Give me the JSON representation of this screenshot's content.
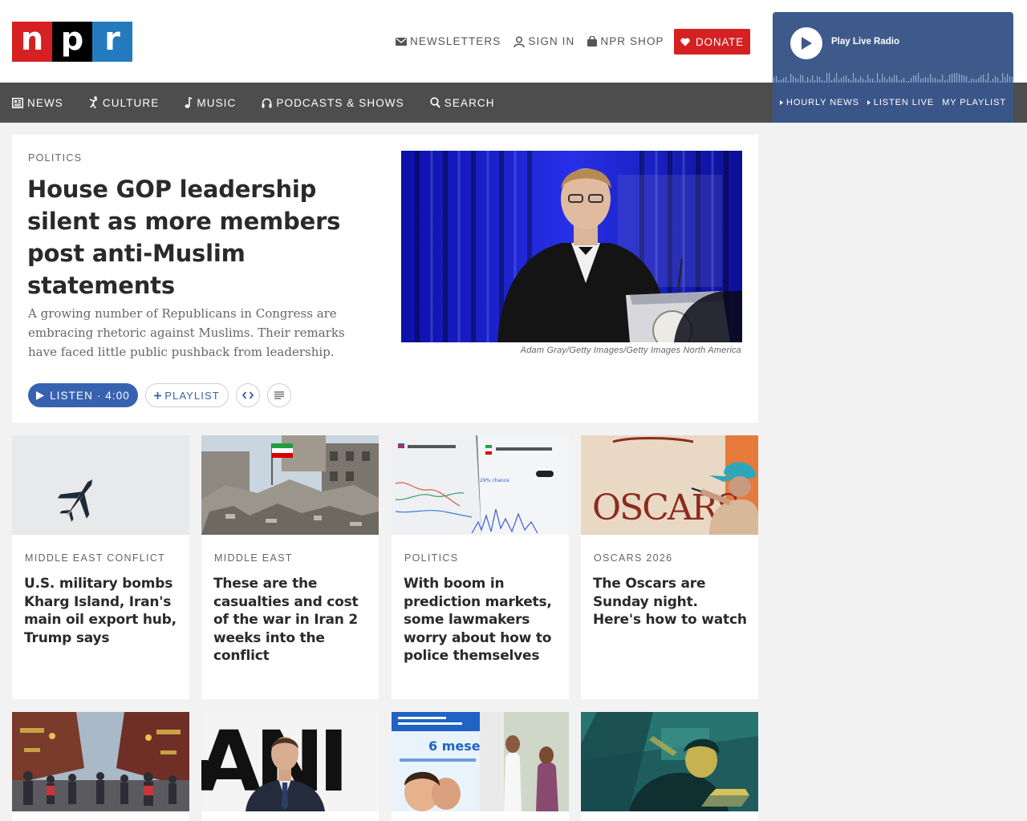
{
  "logo": {
    "letters": [
      "n",
      "p",
      "r"
    ],
    "colors": [
      "#d62021",
      "#000000",
      "#237bbd"
    ]
  },
  "utility": {
    "newsletters": {
      "label": "NEWSLETTERS",
      "icon": "envelope-icon"
    },
    "sign_in": {
      "label": "SIGN IN",
      "icon": "user-icon"
    },
    "shop": {
      "label": "NPR SHOP",
      "icon": "shopping-bag-icon"
    },
    "donate": {
      "label": "DONATE",
      "icon": "heart-icon",
      "color": "#d62021"
    }
  },
  "nav": [
    {
      "label": "NEWS",
      "icon": "newspaper-icon"
    },
    {
      "label": "CULTURE",
      "icon": "dancer-icon"
    },
    {
      "label": "MUSIC",
      "icon": "music-note-icon"
    },
    {
      "label": "PODCASTS & SHOWS",
      "icon": "headphones-icon"
    },
    {
      "label": "SEARCH",
      "icon": "search-icon"
    }
  ],
  "player": {
    "title": "Play Live Radio",
    "links": [
      "HOURLY NEWS",
      "LISTEN LIVE",
      "MY PLAYLIST"
    ],
    "bg_color": "#3d5a8a"
  },
  "featured": {
    "slug": "POLITICS",
    "title": "House GOP leadership silent as more members post anti-Muslim statements",
    "teaser": "A growing number of Republicans in Congress are embracing rhetoric against Muslims. Their remarks have faced little public pushback from leadership.",
    "listen_label": "LISTEN · 4:00",
    "playlist_label": "PLAYLIST",
    "caption": "Adam Gray/Getty Images/Getty Images North America",
    "accent": "#3762b0"
  },
  "cards": [
    {
      "slug": "MIDDLE EAST CONFLICT",
      "title": "U.S. military bombs Kharg Island, Iran's main oil export hub, Trump says"
    },
    {
      "slug": "MIDDLE EAST",
      "title": "These are the casualties and cost of the war in Iran 2 weeks into the conflict"
    },
    {
      "slug": "POLITICS",
      "title": "With boom in prediction markets, some lawmakers worry about how to police themselves"
    },
    {
      "slug": "OSCARS 2026",
      "title": "The Oscars are Sunday night. Here's how to watch"
    }
  ],
  "images": {
    "oscars_sign": "OSCARS",
    "poster_text": "6 meses",
    "ani_text": "ANI"
  }
}
